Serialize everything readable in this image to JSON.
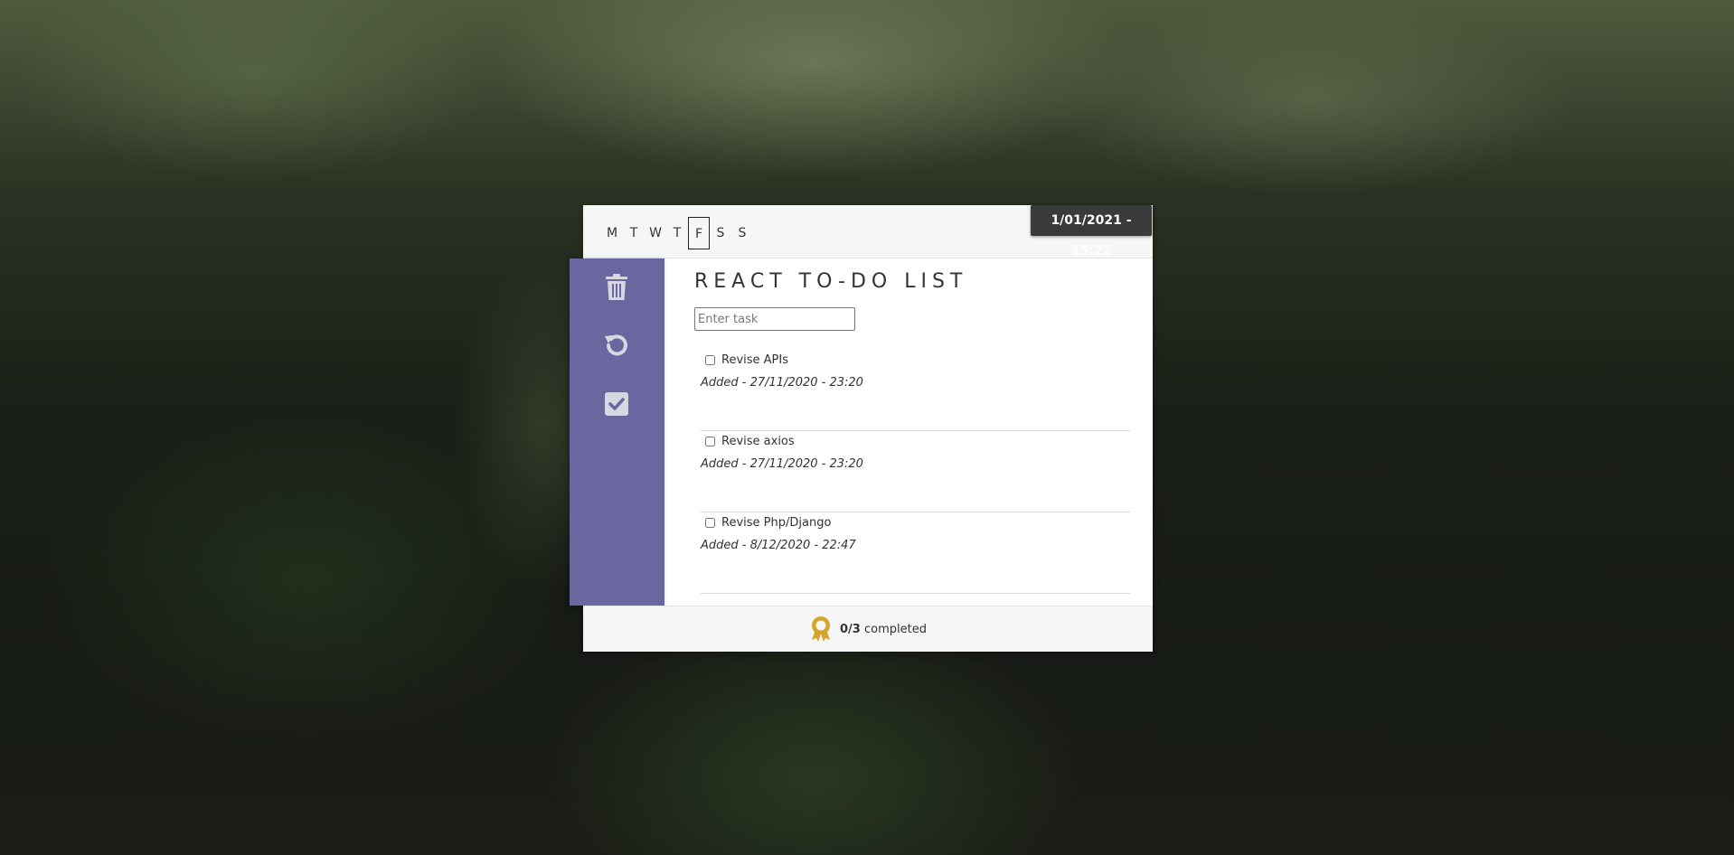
{
  "header": {
    "datetime": "1/01/2021 - 15:22",
    "days": [
      "M",
      "T",
      "W",
      "T",
      "F",
      "S",
      "S"
    ],
    "active_day_index": 4
  },
  "sidebar": {
    "items": [
      {
        "icon": "trash-icon"
      },
      {
        "icon": "undo-icon"
      },
      {
        "icon": "checkbox-checked-icon"
      }
    ]
  },
  "main": {
    "title": "REACT TO-DO LIST",
    "input_placeholder": "Enter task",
    "input_value": "",
    "tasks": [
      {
        "name": "Revise APIs",
        "added": "Added - 27/11/2020 - 23:20",
        "done": false
      },
      {
        "name": "Revise axios",
        "added": "Added - 27/11/2020 - 23:20",
        "done": false
      },
      {
        "name": "Revise Php/Django",
        "added": "Added - 8/12/2020 - 22:47",
        "done": false
      }
    ]
  },
  "footer": {
    "icon": "award-ribbon-icon",
    "count": "0/3",
    "label": "completed"
  },
  "colors": {
    "sidebar": "#6a66a0",
    "award": "#d3a52c",
    "datetime_bg": "#3a3a3a"
  }
}
